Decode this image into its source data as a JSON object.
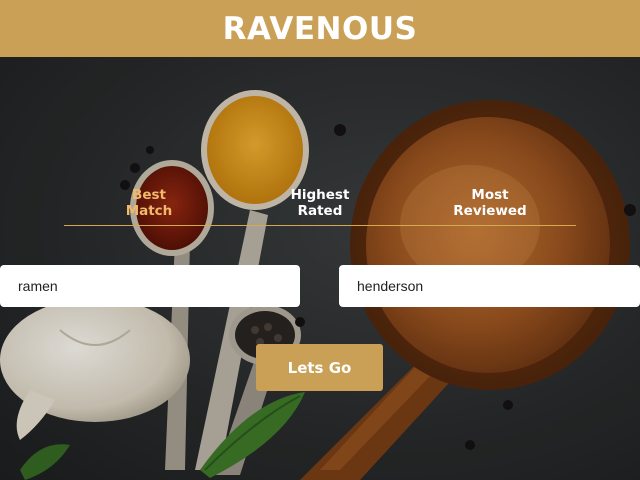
{
  "app": {
    "title": "RAVENOUS"
  },
  "sort_options": [
    {
      "label_line1": "Best",
      "label_line2": "Match",
      "active": true
    },
    {
      "label_line1": "Highest",
      "label_line2": "Rated",
      "active": false
    },
    {
      "label_line1": "Most",
      "label_line2": "Reviewed",
      "active": false
    }
  ],
  "search": {
    "term_value": "ramen",
    "location_value": "henderson",
    "submit_label": "Lets Go"
  },
  "colors": {
    "brand": "#c9a055",
    "active_tab": "#f2b96b",
    "divider": "#d6a94e"
  },
  "icons": {
    "background": "spices-and-wooden-spoon-photo"
  }
}
